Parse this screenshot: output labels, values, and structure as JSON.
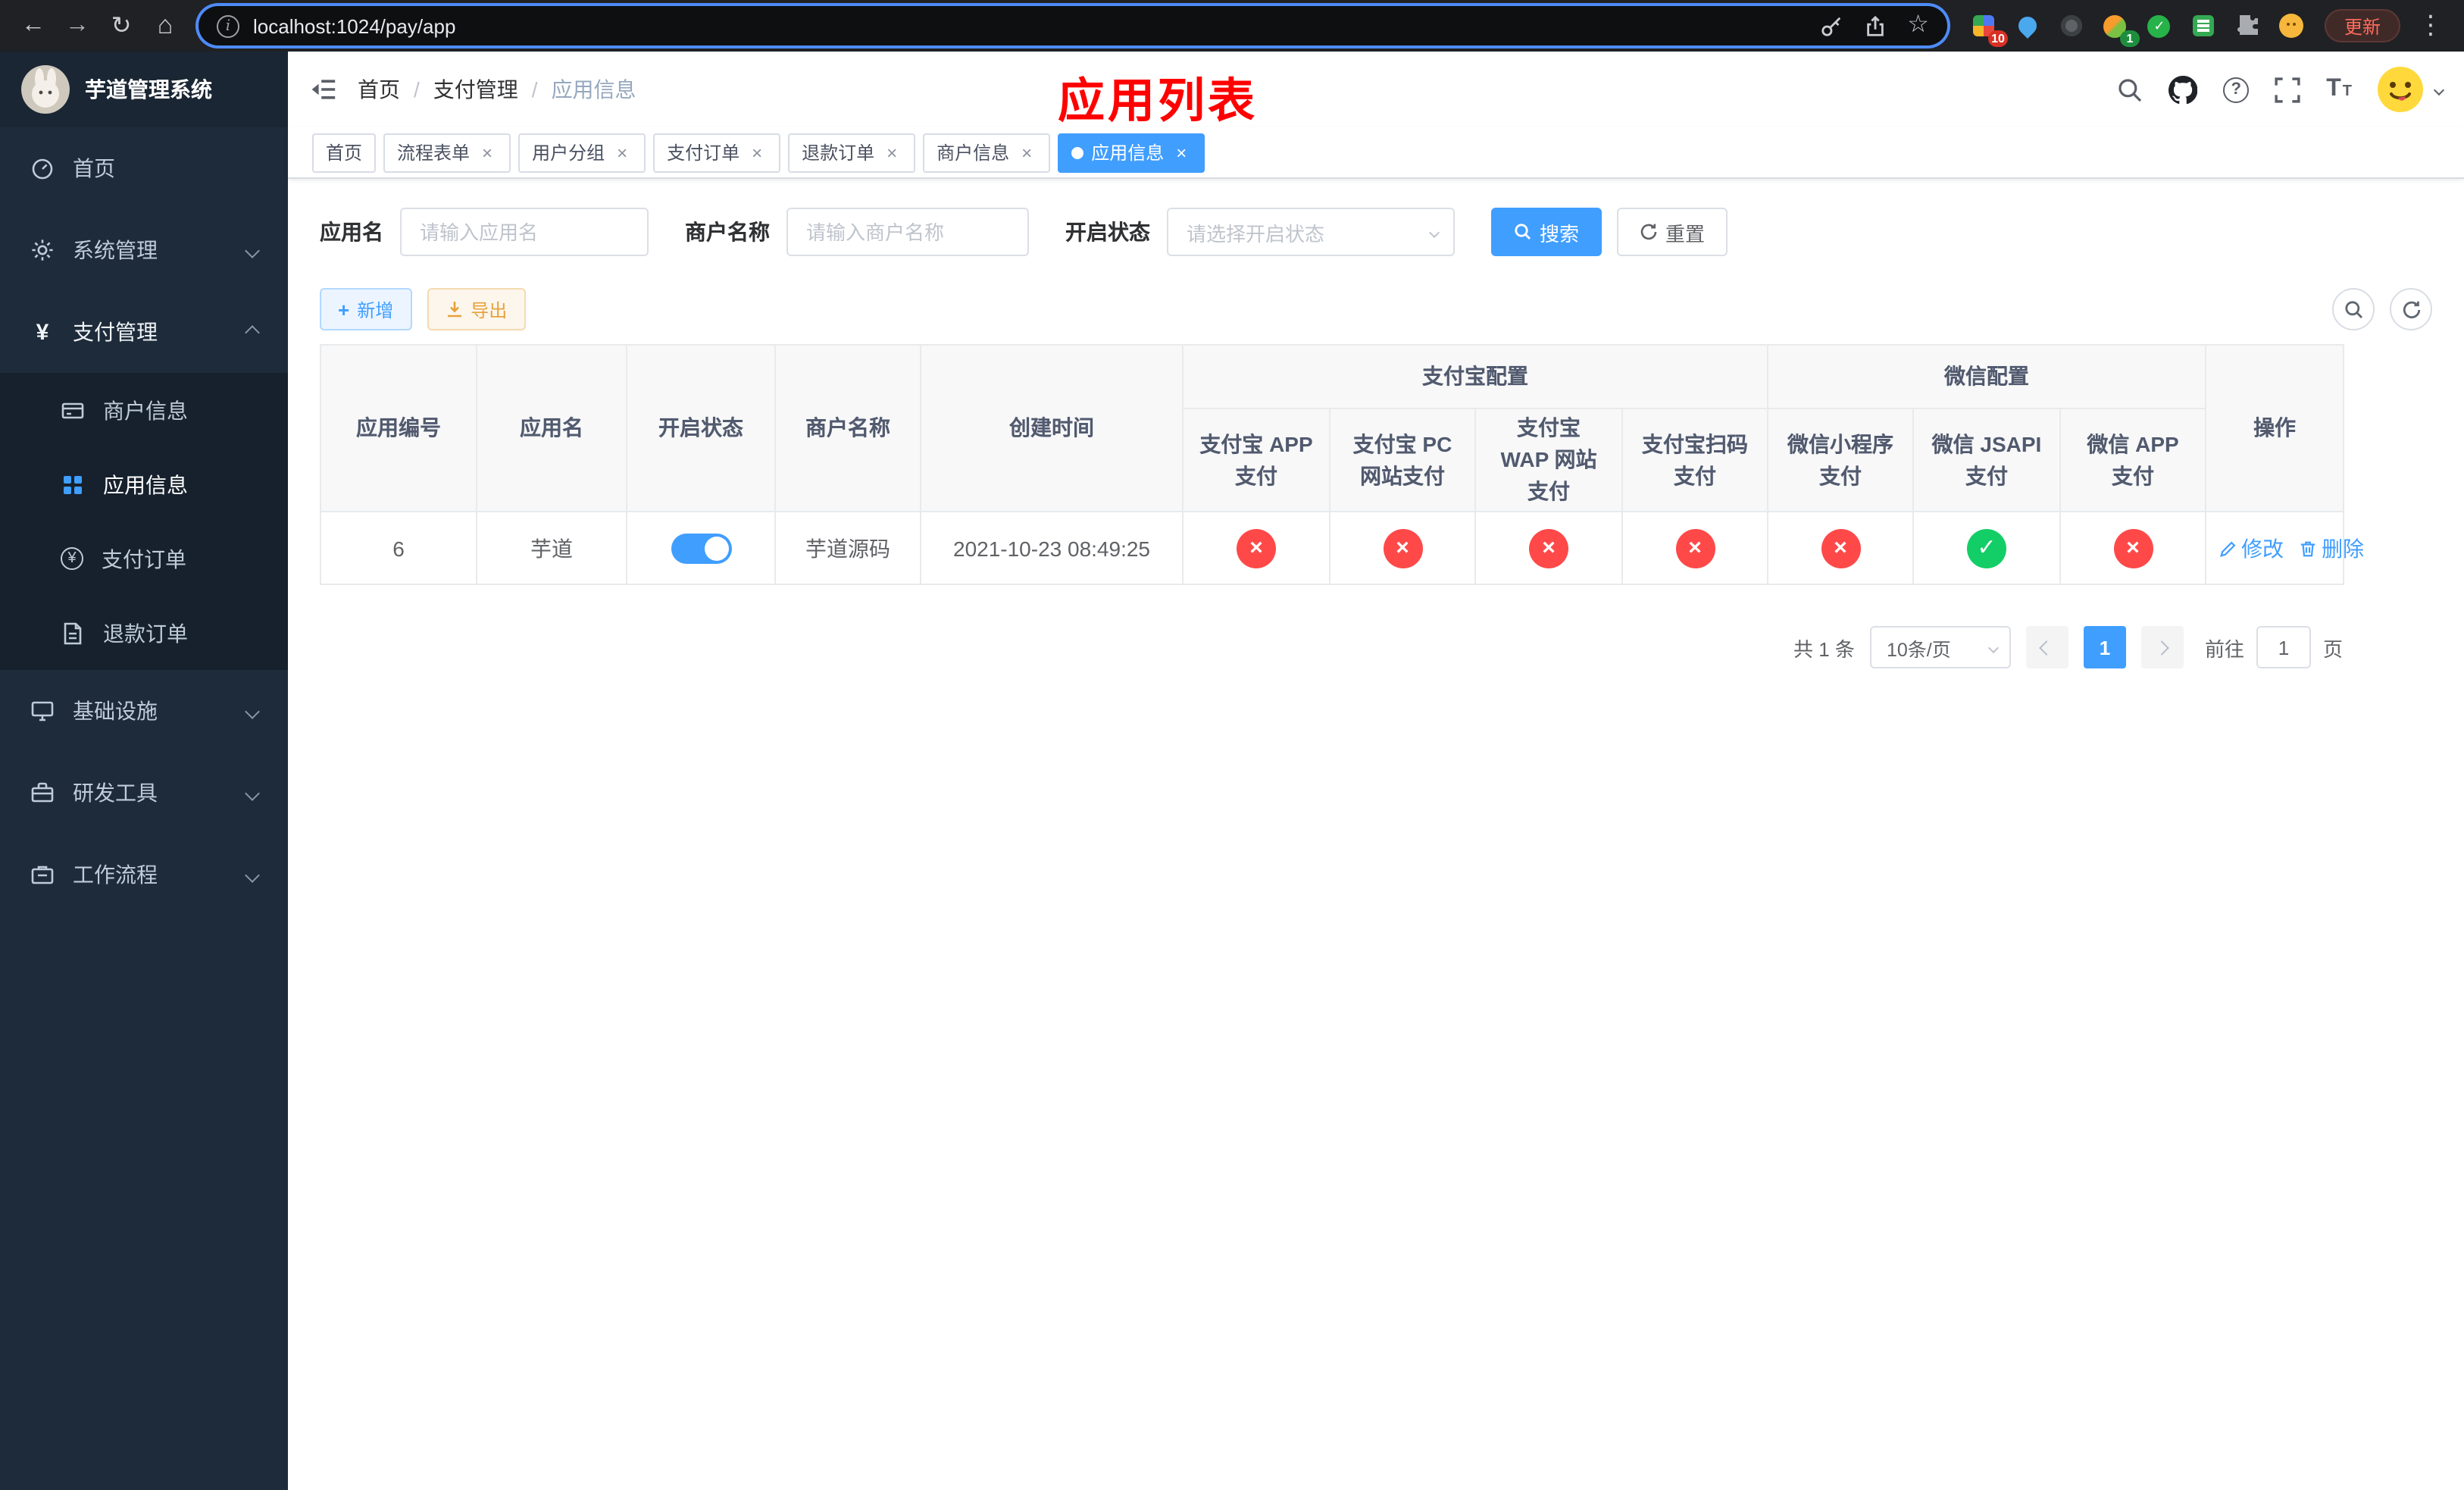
{
  "colors": {
    "accent": "#409eff",
    "success": "#13ce66",
    "fail": "#ff4949",
    "warning": "#e6a23c",
    "annotation": "#ff0000"
  },
  "browser": {
    "url": "localhost:1024/pay/app",
    "update_label": "更新",
    "ext_badge_grid": "10",
    "ext_badge_avatar": "1"
  },
  "annotation": {
    "text": "应用列表"
  },
  "sidebar": {
    "title": "芋道管理系统",
    "menu": [
      {
        "label": "首页"
      },
      {
        "label": "系统管理"
      },
      {
        "label": "支付管理"
      },
      {
        "label": "基础设施"
      },
      {
        "label": "研发工具"
      },
      {
        "label": "工作流程"
      }
    ],
    "submenu": [
      {
        "label": "商户信息"
      },
      {
        "label": "应用信息"
      },
      {
        "label": "支付订单"
      },
      {
        "label": "退款订单"
      }
    ]
  },
  "navbar": {
    "breadcrumb": [
      "首页",
      "支付管理",
      "应用信息"
    ]
  },
  "tags": [
    {
      "label": "首页"
    },
    {
      "label": "流程表单"
    },
    {
      "label": "用户分组"
    },
    {
      "label": "支付订单"
    },
    {
      "label": "退款订单"
    },
    {
      "label": "商户信息"
    },
    {
      "label": "应用信息"
    }
  ],
  "filters": {
    "app_name_label": "应用名",
    "app_name_placeholder": "请输入应用名",
    "merchant_label": "商户名称",
    "merchant_placeholder": "请输入商户名称",
    "status_label": "开启状态",
    "status_placeholder": "请选择开启状态",
    "search_label": "搜索",
    "reset_label": "重置"
  },
  "toolbar": {
    "add_label": "新增",
    "export_label": "导出"
  },
  "table": {
    "group_alipay": "支付宝配置",
    "group_wechat": "微信配置",
    "col_id": "应用编号",
    "col_name": "应用名",
    "col_status": "开启状态",
    "col_merchant": "商户名称",
    "col_created": "创建时间",
    "col_alipay_app": "支付宝 APP 支付",
    "col_alipay_pc": "支付宝 PC 网站支付",
    "col_alipay_wap": "支付宝 WAP 网站支付",
    "col_alipay_qr": "支付宝扫码支付",
    "col_wx_mini": "微信小程序支付",
    "col_wx_jsapi": "微信 JSAPI 支付",
    "col_wx_app": "微信 APP 支付",
    "col_action": "操作",
    "row": {
      "id": "6",
      "name": "芋道",
      "switch_on": true,
      "merchant": "芋道源码",
      "created": "2021-10-23 08:49:25",
      "channels": [
        "fail",
        "fail",
        "fail",
        "fail",
        "fail",
        "success",
        "fail"
      ],
      "edit_label": "修改",
      "delete_label": "删除"
    }
  },
  "pagination": {
    "total": "共 1 条",
    "page_size": "10条/页",
    "page": "1",
    "goto_prefix": "前往",
    "goto_value": "1",
    "goto_suffix": "页"
  }
}
